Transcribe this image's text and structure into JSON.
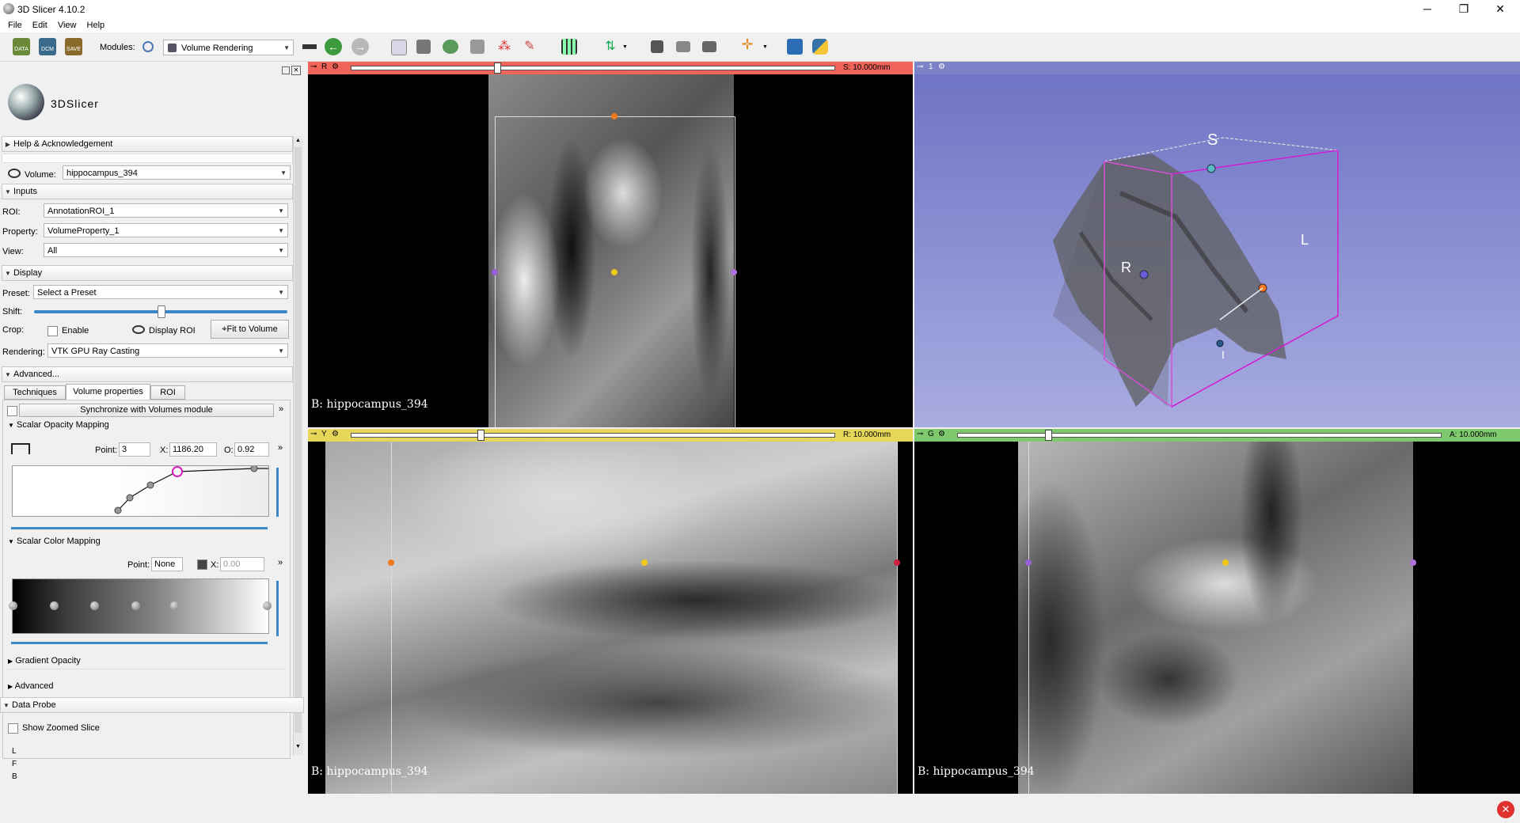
{
  "window": {
    "title": "3D Slicer 4.10.2",
    "minimize": "─",
    "maximize": "❐",
    "close": "✕"
  },
  "menu": [
    "File",
    "Edit",
    "View",
    "Help"
  ],
  "toolbar": {
    "data_label": "DATA",
    "dcm_label": "DCM",
    "save_label": "SAVE",
    "modules_label": "Modules:",
    "module_selected": "Volume Rendering"
  },
  "panel": {
    "logo_text": "3DSlicer",
    "help_section": "Help & Acknowledgement",
    "volume_label": "Volume:",
    "volume_value": "hippocampus_394",
    "inputs_section": "Inputs",
    "roi_label": "ROI:",
    "roi_value": "AnnotationROI_1",
    "property_label": "Property:",
    "property_value": "VolumeProperty_1",
    "view_label": "View:",
    "view_value": "All",
    "display_section": "Display",
    "preset_label": "Preset:",
    "preset_value": "Select a Preset",
    "shift_label": "Shift:",
    "shift_level": 0.5,
    "crop_label": "Crop:",
    "enable_label": "Enable",
    "display_roi_label": "Display ROI",
    "fit_button": "Fit to Volume",
    "rendering_label": "Rendering:",
    "rendering_value": "VTK GPU Ray Casting",
    "advanced_section": "Advanced...",
    "tabs": [
      "Techniques",
      "Volume properties",
      "ROI"
    ],
    "sync_button": "Synchronize with Volumes module",
    "opacity_section": "Scalar Opacity Mapping",
    "point_label": "Point:",
    "point_value": "3",
    "x_label": "X:",
    "x_value": "1186.20",
    "o_label": "O:",
    "o_value": "0.92",
    "color_section": "Scalar Color Mapping",
    "color_point_value": "None",
    "color_x_value": "0.00",
    "gradient_section": "Gradient Opacity",
    "advanced_sub_section": "Advanced",
    "data_probe_section": "Data Probe",
    "show_zoomed_label": "Show Zoomed Slice",
    "probe_lines": [
      "L",
      "F",
      "B"
    ]
  },
  "views": {
    "red": {
      "letter": "R",
      "offset": "S: 10.000mm",
      "label": "B: hippocampus_394",
      "color": "#f0645a"
    },
    "three_d": {
      "letter": "1",
      "axis_s": "S",
      "axis_l": "L",
      "axis_r": "R",
      "axis_i": "I",
      "color": "#7b82c8"
    },
    "yellow": {
      "letter": "Y",
      "offset": "R: 10.000mm",
      "label": "B: hippocampus_394",
      "color": "#e6d65a"
    },
    "green": {
      "letter": "G",
      "offset": "A: 10.000mm",
      "label": "B: hippocampus_394",
      "color": "#7ec96e"
    }
  }
}
